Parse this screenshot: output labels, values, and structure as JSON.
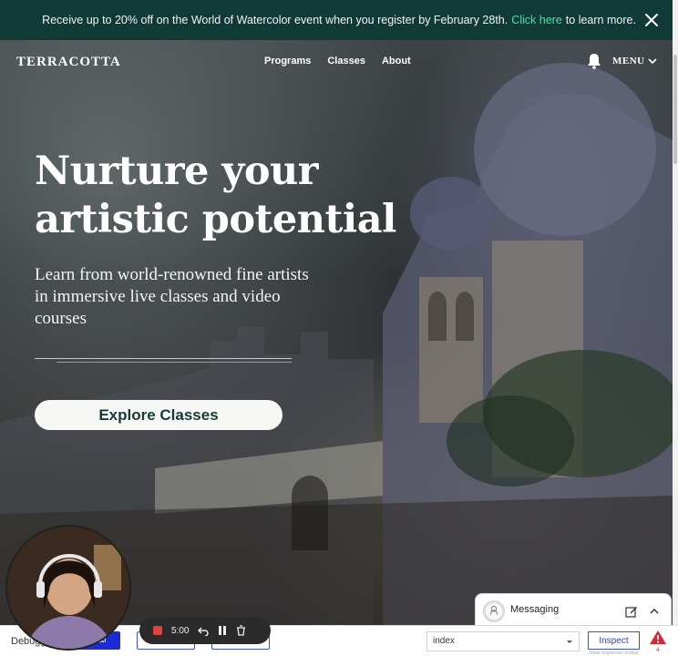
{
  "promo": {
    "message": "Receive up to 20% off on the World of Watercolor event when you register by February 28th.",
    "link": "Click here",
    "suffix": "to learn more."
  },
  "header": {
    "brand": "TERRACOTTA",
    "nav": [
      "Programs",
      "Classes",
      "About"
    ],
    "menu_label": "MENU"
  },
  "hero": {
    "headline_line1": "Nurture your",
    "headline_line2": "artistic potential",
    "subhead": "Learn from world-renowned fine artists in immersive live classes and video courses",
    "cta": "Explore Classes"
  },
  "recorder": {
    "time": "5:00"
  },
  "devbar": {
    "debug_label": "Debugg",
    "blue_button_label": "al",
    "select_value": "index",
    "inspect_label": "Inspect",
    "tiny_note": "Show responsive toolbar",
    "warning_count": "4"
  },
  "messaging": {
    "title": "Messaging"
  },
  "colors": {
    "banner": "#103a36",
    "link": "#46e6a3",
    "cta_text": "#163a36",
    "cta_bg": "#f7f7f5"
  }
}
